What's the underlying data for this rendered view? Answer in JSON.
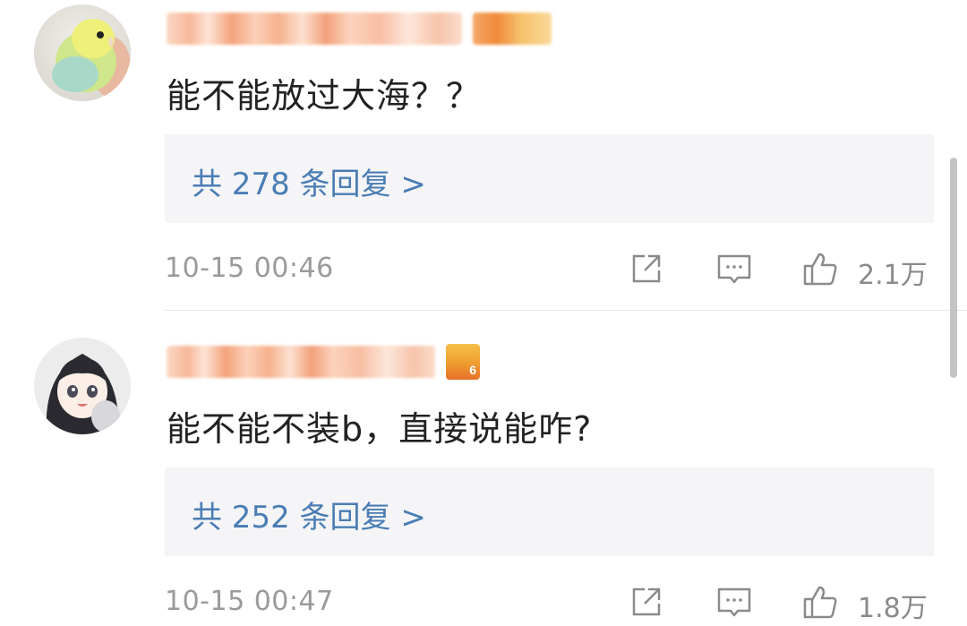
{
  "comments": [
    {
      "text": "能不能放过大海？？",
      "replies_label": "共 278 条回复 >",
      "timestamp": "10-15 00:46",
      "likes": "2.1万",
      "avatar": "parrot-avatar"
    },
    {
      "text": "能不能不装b，直接说能咋?",
      "replies_label": "共 252 条回复 >",
      "timestamp": "10-15 00:47",
      "likes": "1.8万",
      "avatar": "anime-girl-avatar",
      "badge_label": "6"
    }
  ],
  "icons": {
    "share": "share-icon",
    "comment": "comment-icon",
    "like": "thumbs-up-icon"
  },
  "colors": {
    "reply_link": "#4a7db4",
    "reply_bg": "#f5f5f7",
    "meta_text": "#9a9a9a"
  }
}
